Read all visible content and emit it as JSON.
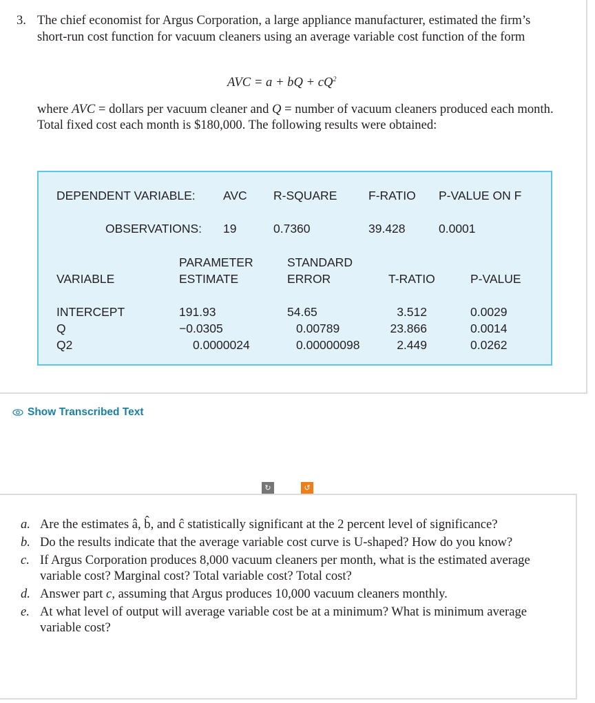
{
  "problem": {
    "number": "3.",
    "intro": "The chief economist for Argus Corporation, a large appliance manufacturer, estimated the firm’s short-run cost function for vacuum cleaners using an average variable cost function of the form",
    "equation": "AVC = a + bQ + cQ",
    "equation_sup": "2",
    "where_prefix": "where ",
    "where_avc": "AVC",
    "where_mid": " = dollars per vacuum cleaner and ",
    "where_q": "Q",
    "where_rest": " = number of vacuum cleaners produced each month. Total fixed cost each month is $180,000. The following results were obtained:"
  },
  "regression": {
    "dependent_label": "DEPENDENT VARIABLE:",
    "dependent_value": "AVC",
    "observations_label": "OBSERVATIONS:",
    "observations_value": "19",
    "r_square_label": "R-SQUARE",
    "r_square_value": "0.7360",
    "f_ratio_label": "F-RATIO",
    "f_ratio_value": "39.428",
    "p_value_f_label": "P-VALUE ON F",
    "p_value_f_value": "0.0001",
    "headers": {
      "variable": "VARIABLE",
      "param_line1": "PARAMETER",
      "param_line2": "ESTIMATE",
      "se_line1": "STANDARD",
      "se_line2": "ERROR",
      "t_ratio": "T-RATIO",
      "p_value": "P-VALUE"
    },
    "rows": [
      {
        "variable": "INTERCEPT",
        "estimate": "191.93",
        "std_error": "54.65",
        "t_ratio": "3.512",
        "p_value": "0.0029"
      },
      {
        "variable": "Q",
        "estimate": "−0.0305",
        "std_error": "0.00789",
        "t_ratio": "23.866",
        "p_value": "0.0014"
      },
      {
        "variable": "Q2",
        "estimate": "0.0000024",
        "std_error": "0.00000098",
        "t_ratio": "2.449",
        "p_value": "0.0262"
      }
    ]
  },
  "controls": {
    "show_transcribed": "Show Transcribed Text",
    "rotate_left_glyph": "↻",
    "rotate_right_glyph": "↺",
    "accent_color": "#1a7fa3",
    "rotate_right_color": "#ef7d1a",
    "rotate_left_color": "#767676"
  },
  "questions": [
    {
      "letter": "a.",
      "pre": "Are the estimates â, b̂, and ĉ statistically significant at the 2 percent level of significance?"
    },
    {
      "letter": "b.",
      "pre": "Do the results indicate that the average variable cost curve is U-shaped? How do you know?"
    },
    {
      "letter": "c.",
      "pre": "If Argus Corporation produces 8,000 vacuum cleaners per month, what is the estimated average variable cost? Marginal cost? Total variable cost? Total cost?"
    },
    {
      "letter": "d.",
      "pre": "Answer part ",
      "italic": "c",
      "post": ", assuming that Argus produces 10,000 vacuum cleaners monthly."
    },
    {
      "letter": "e.",
      "pre": "At what level of output will average variable cost be at a minimum? What is minimum average variable cost?"
    }
  ]
}
